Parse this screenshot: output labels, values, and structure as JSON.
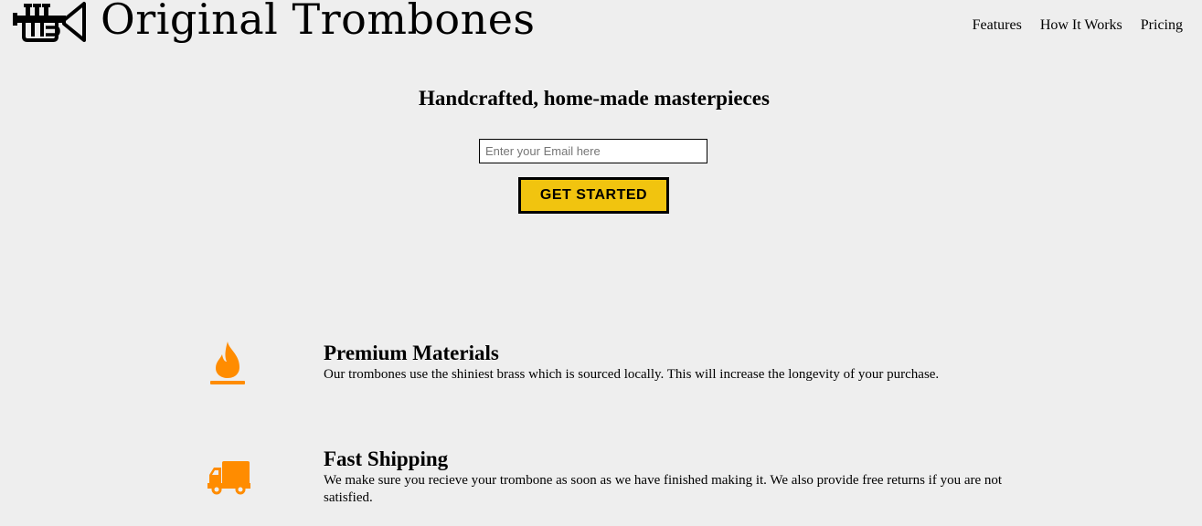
{
  "header": {
    "logo_icon": "trumpet-icon",
    "brand": "Original Trombones",
    "nav": [
      {
        "label": "Features"
      },
      {
        "label": "How It Works"
      },
      {
        "label": "Pricing"
      }
    ]
  },
  "hero": {
    "title": "Handcrafted, home-made masterpieces",
    "email_placeholder": "Enter your Email here",
    "email_value": "",
    "cta_label": "GET STARTED"
  },
  "features": [
    {
      "icon": "fire-icon",
      "title": "Premium Materials",
      "description": "Our trombones use the shiniest brass which is sourced locally. This will increase the longevity of your purchase."
    },
    {
      "icon": "truck-icon",
      "title": "Fast Shipping",
      "description": "We make sure you recieve your trombone as soon as we have finished making it. We also provide free returns if you are not satisfied."
    }
  ],
  "colors": {
    "background": "#eeeeee",
    "cta": "#f1c40f",
    "icon_accent": "#ff8c00"
  }
}
